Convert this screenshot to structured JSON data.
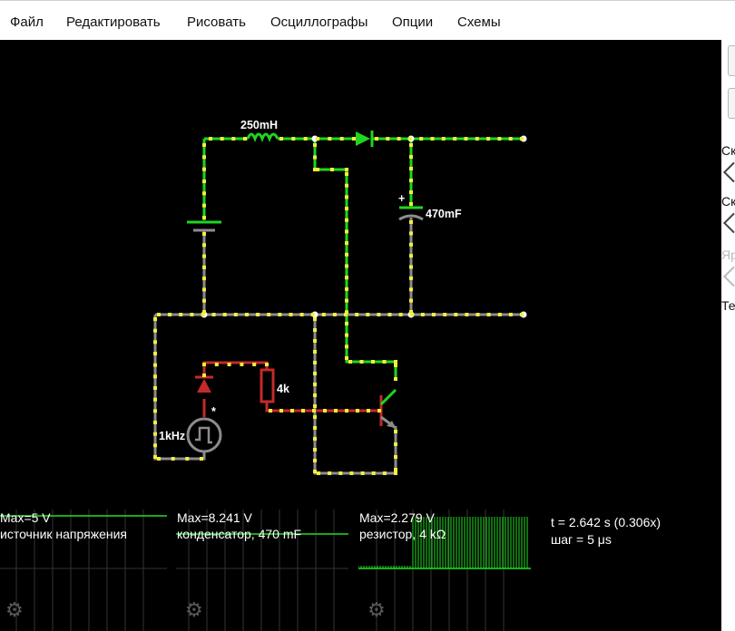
{
  "menu": {
    "file": "Файл",
    "edit": "Редактировать",
    "draw": "Рисовать",
    "scopes": "Осциллографы",
    "options": "Опции",
    "circuits": "Схемы"
  },
  "circuit": {
    "inductor_label": "250mH",
    "capacitor_label": "470mF",
    "capacitor_polarity": "+",
    "resistor_label": "4k",
    "source_label": "1kHz",
    "source_marker": "*"
  },
  "sidebar": {
    "label_1": "Ск",
    "label_2": "Ск",
    "label_3": "Яр",
    "label_4": "Те"
  },
  "scopes": [
    {
      "max": "Max=5 V",
      "name": "источник напряжения"
    },
    {
      "max": "Max=8.241 V",
      "name": "конденсатор, 470 mF"
    },
    {
      "max": "Max=2.279 V",
      "name": "резистор, 4 kΩ"
    }
  ],
  "scope_info": {
    "time": "t = 2.642 s (0.306x)",
    "step": "шаг = 5 μs"
  },
  "colors": {
    "wire_green": "#1fd61f",
    "wire_gray": "#8c8c8c",
    "wire_red": "#c42a2a",
    "dot_yellow": "#f4ee3a",
    "background": "#000000",
    "scope_trace": "#22dd22"
  },
  "icons": {
    "scope_settings": "gear-icon"
  }
}
